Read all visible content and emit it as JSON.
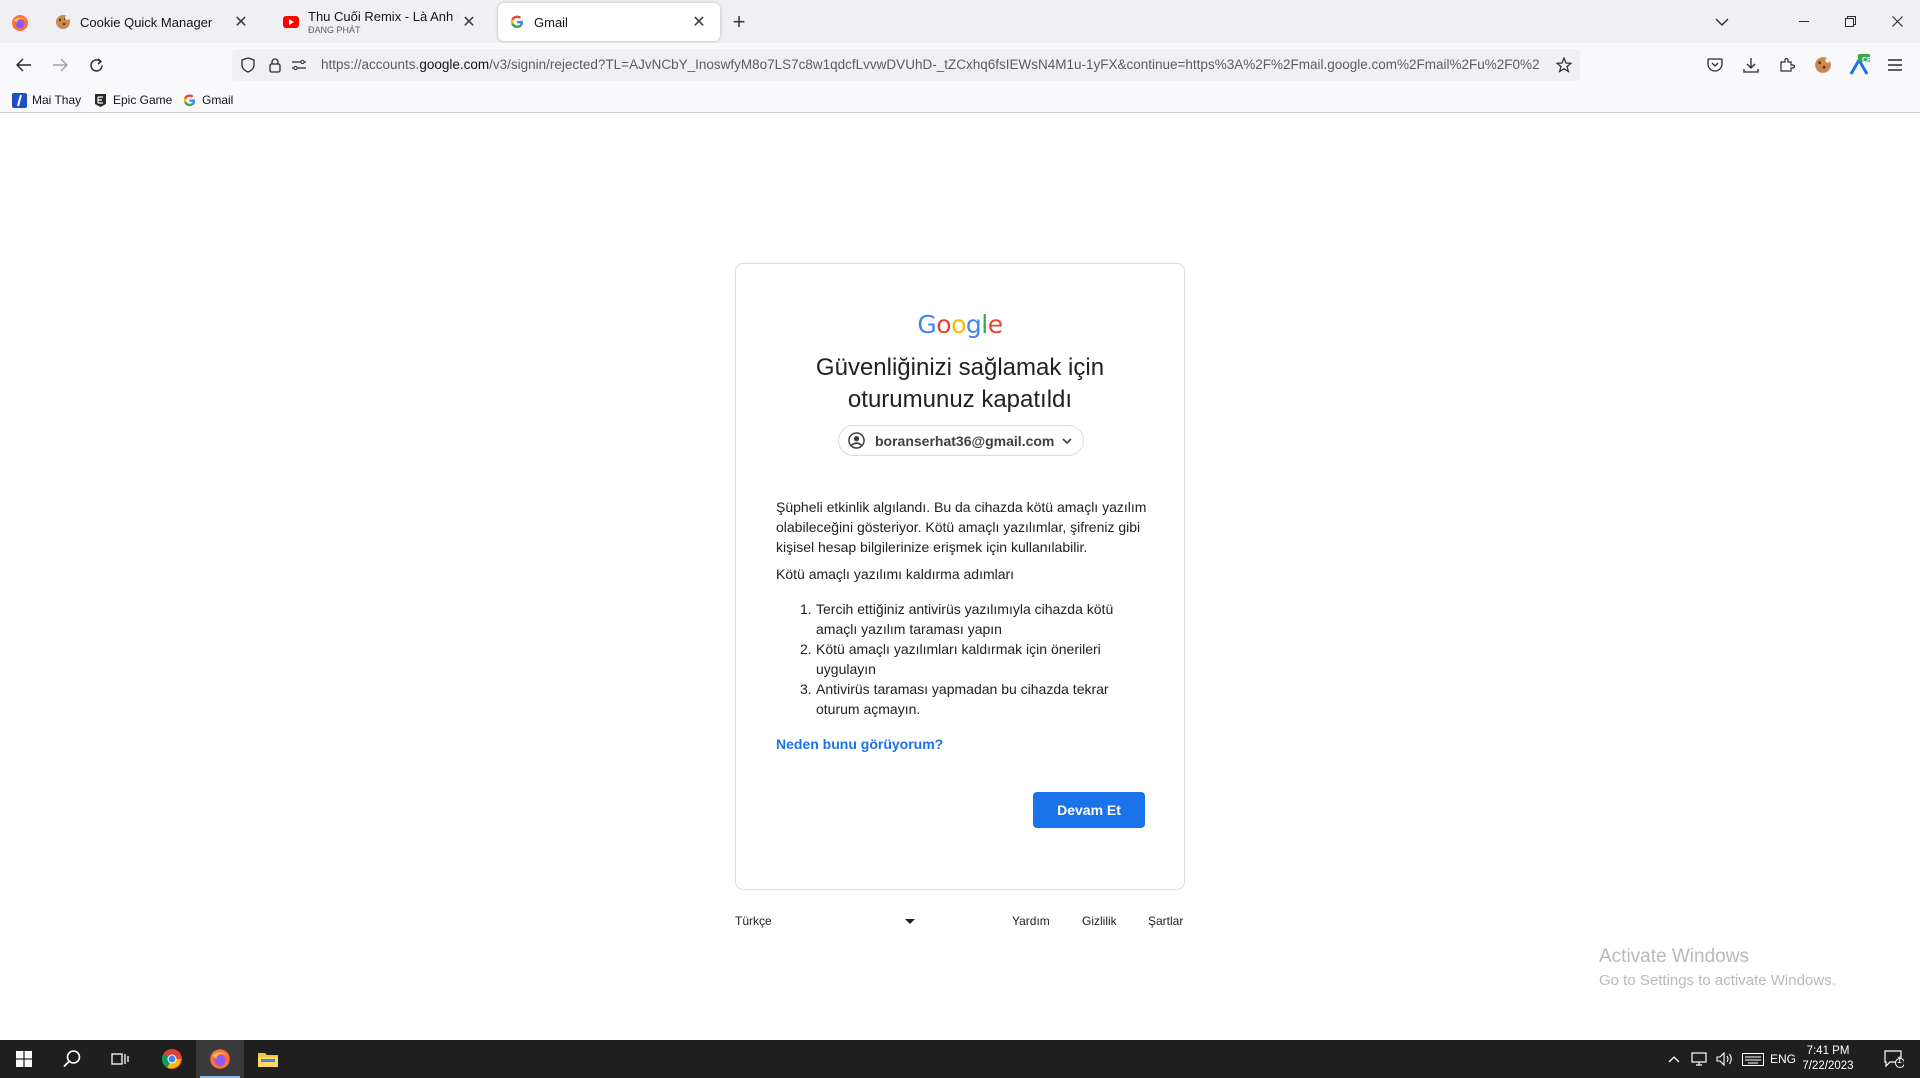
{
  "browser": {
    "tabs": [
      {
        "title": "Cookie Quick Manager",
        "subtitle": "",
        "active": false
      },
      {
        "title": "Thu Cuối Remix - Là Anh Remix",
        "subtitle": "ĐANG PHÁT",
        "active": false
      },
      {
        "title": "Gmail",
        "subtitle": "",
        "active": true
      }
    ],
    "url": {
      "prefix": "https://accounts.",
      "host": "google.com",
      "rest": "/v3/signin/rejected?TL=AJvNCbY_InoswfyM8o7LS7c8w1qdcfLvvwDVUhD-_tZCxhq6fsIEWsN4M1u-1yFX&continue=https%3A%2F%2Fmail.google.com%2Fmail%2Fu%2F0%2"
    },
    "bookmarks": [
      {
        "label": "Mai Thay"
      },
      {
        "label": "Epic Game"
      },
      {
        "label": "Gmail"
      }
    ],
    "extension_badge": "CR"
  },
  "page": {
    "logo_letters": [
      {
        "ch": "G",
        "color": "#4285F4"
      },
      {
        "ch": "o",
        "color": "#EA4335"
      },
      {
        "ch": "o",
        "color": "#FBBC05"
      },
      {
        "ch": "g",
        "color": "#4285F4"
      },
      {
        "ch": "l",
        "color": "#34A853"
      },
      {
        "ch": "e",
        "color": "#EA4335"
      }
    ],
    "heading_line1": "Güvenliğinizi sağlamak için",
    "heading_line2": "oturumunuz kapatıldı",
    "account_email": "boranserhat36@gmail.com",
    "para1": "Şüpheli etkinlik algılandı. Bu da cihazda kötü amaçlı yazılım olabileceğini gösteriyor. Kötü amaçlı yazılımlar, şifreniz gibi kişisel hesap bilgilerinize erişmek için kullanılabilir.",
    "steps_title": "Kötü amaçlı yazılımı kaldırma adımları",
    "steps": [
      {
        "num": "1.",
        "text": "Tercih ettiğiniz antivirüs yazılımıyla cihazda kötü amaçlı yazılım taraması yapın"
      },
      {
        "num": "2.",
        "text": "Kötü amaçlı yazılımları kaldırmak için önerileri uygulayın"
      },
      {
        "num": "3.",
        "text": "Antivirüs taraması yapmadan bu cihazda tekrar oturum açmayın."
      }
    ],
    "why_link": "Neden bunu görüyorum?",
    "continue_button": "Devam Et",
    "footer": {
      "language": "Türkçe",
      "help": "Yardım",
      "privacy": "Gizlilik",
      "terms": "Şartlar"
    },
    "accent_color": "#1a73e8"
  },
  "watermark": {
    "line1": "Activate Windows",
    "line2": "Go to Settings to activate Windows."
  },
  "taskbar": {
    "language": "ENG",
    "time": "7:41 PM",
    "date": "7/22/2023",
    "notification_count": "1"
  }
}
